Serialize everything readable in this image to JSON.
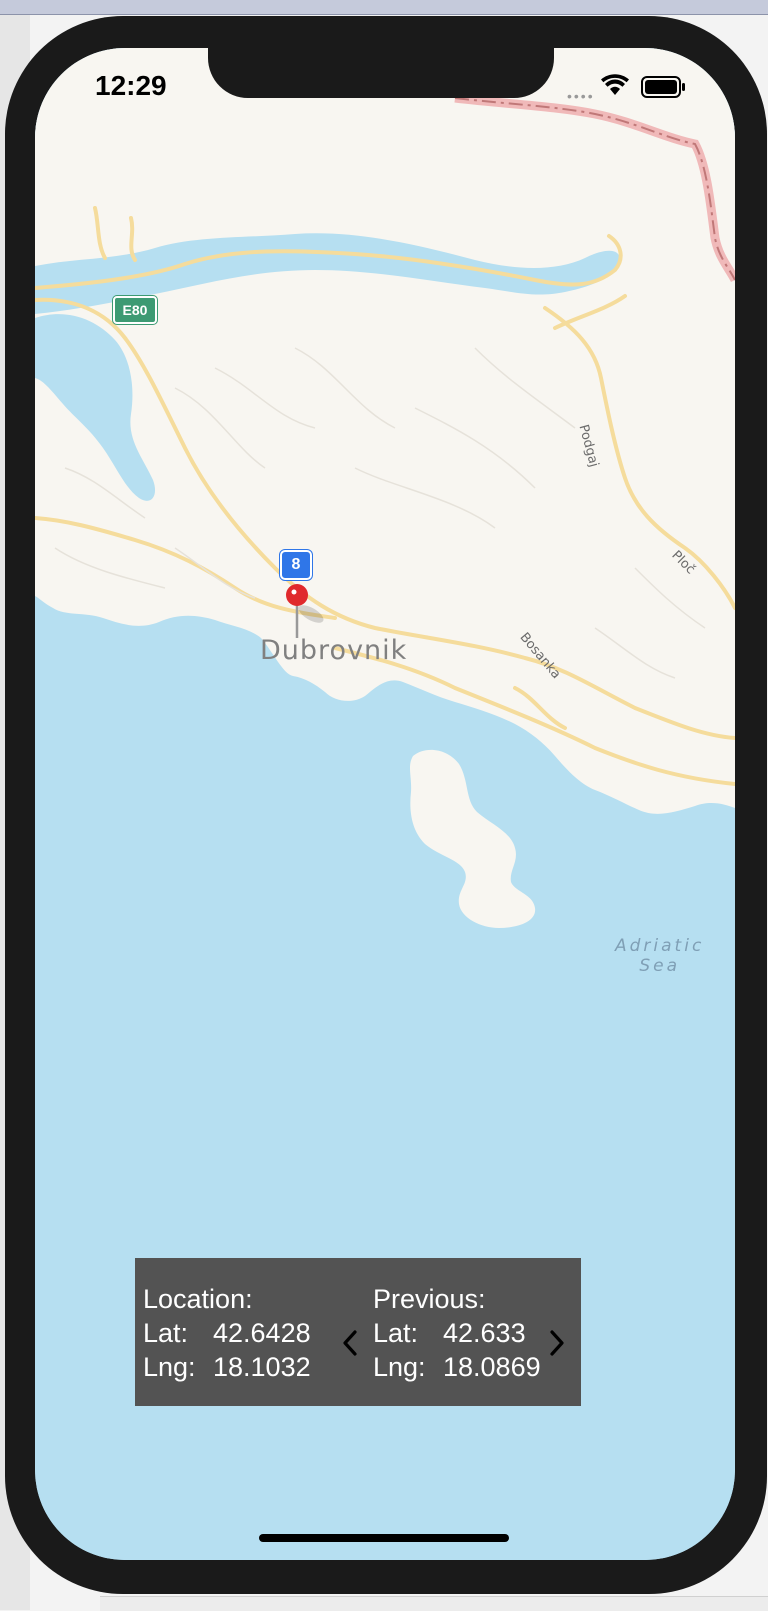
{
  "status_bar": {
    "time": "12:29"
  },
  "map": {
    "city_label": "Dubrovnik",
    "sea_label_line1": "Adriatic",
    "sea_label_line2": "Sea",
    "road_labels": {
      "podgaj": "Podgaj",
      "ploc": "Ploč",
      "bosanka": "Bosanka"
    },
    "route_shields": {
      "e80": "E80",
      "route8": "8"
    },
    "colors": {
      "land": "#f8f6f1",
      "water": "#b6dff1",
      "road": "#f5dc9c",
      "border": "#e8a8a8",
      "pin": "#e0292c"
    }
  },
  "info_panel": {
    "current": {
      "heading": "Location:",
      "lat_label": "Lat:",
      "lat_value": "42.6428",
      "lng_label": "Lng:",
      "lng_value": "18.1032"
    },
    "previous": {
      "heading": "Previous:",
      "lat_label": "Lat:",
      "lat_value": "42.633",
      "lng_label": "Lng:",
      "lng_value": "18.0869"
    },
    "prev_icon": "chevron-left-icon",
    "next_icon": "chevron-right-icon"
  }
}
